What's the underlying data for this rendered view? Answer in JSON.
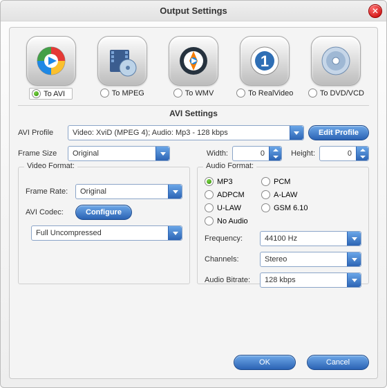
{
  "title": "Output Settings",
  "formats": {
    "items": [
      {
        "label": "To AVI",
        "selected": true
      },
      {
        "label": "To MPEG",
        "selected": false
      },
      {
        "label": "To WMV",
        "selected": false
      },
      {
        "label": "To RealVideo",
        "selected": false
      },
      {
        "label": "To DVD/VCD",
        "selected": false
      }
    ]
  },
  "section_title": "AVI Settings",
  "avi_profile": {
    "label": "AVI Profile",
    "value": "Video: XviD (MPEG 4); Audio: Mp3 - 128 kbps",
    "edit_button": "Edit Profile"
  },
  "frame_size": {
    "label": "Frame Size",
    "value": "Original"
  },
  "width": {
    "label": "Width:",
    "value": "0"
  },
  "height": {
    "label": "Height:",
    "value": "0"
  },
  "video_group": {
    "title": "Video Format:",
    "frame_rate": {
      "label": "Frame Rate:",
      "value": "Original"
    },
    "avi_codec": {
      "label": "AVI Codec:",
      "button": "Configure"
    },
    "codec_value": "Full Uncompressed"
  },
  "audio_group": {
    "title": "Audio Format:",
    "options": [
      "MP3",
      "PCM",
      "ADPCM",
      "A-LAW",
      "U-LAW",
      "GSM 6.10",
      "No Audio"
    ],
    "selected": "MP3",
    "frequency": {
      "label": "Frequency:",
      "value": "44100 Hz"
    },
    "channels": {
      "label": "Channels:",
      "value": "Stereo"
    },
    "bitrate": {
      "label": "Audio Bitrate:",
      "value": "128 kbps"
    }
  },
  "buttons": {
    "ok": "OK",
    "cancel": "Cancel"
  }
}
